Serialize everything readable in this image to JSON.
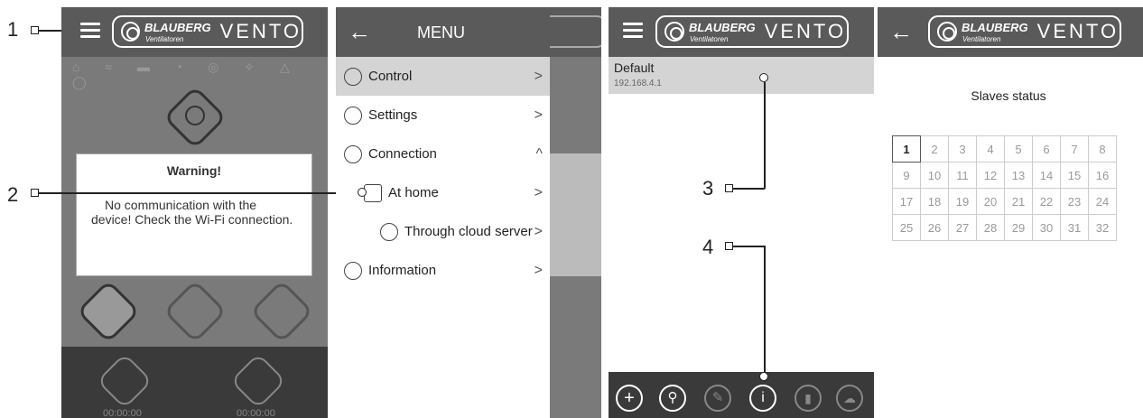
{
  "callouts": {
    "c1": "1",
    "c2": "2",
    "c3": "3",
    "c4": "4"
  },
  "panel1": {
    "logo_line1": "BLAUBERG",
    "logo_line2": "Ventilatoren",
    "logo_vento": "VENTO",
    "warning_title": "Warning!",
    "warning_text": "No communication with the device! Check the Wi-Fi connection.",
    "timer1": "00:00:00",
    "timer2": "00:00:00"
  },
  "panel2": {
    "menu_title": "MENU",
    "items": [
      {
        "label": "Control",
        "arrow": ">"
      },
      {
        "label": "Settings",
        "arrow": ">"
      },
      {
        "label": "Connection",
        "arrow": "^"
      },
      {
        "label": "At home",
        "arrow": ">"
      },
      {
        "label": "Through cloud server",
        "arrow": ">"
      },
      {
        "label": "Information",
        "arrow": ">"
      }
    ]
  },
  "panel3": {
    "logo_line1": "BLAUBERG",
    "logo_line2": "Ventilatoren",
    "logo_vento": "VENTO",
    "device_name": "Default",
    "device_ip": "192.168.4.1"
  },
  "panel4": {
    "logo_line1": "BLAUBERG",
    "logo_line2": "Ventilatoren",
    "logo_vento": "VENTO",
    "title": "Slaves status",
    "slaves": [
      "1",
      "2",
      "3",
      "4",
      "5",
      "6",
      "7",
      "8",
      "9",
      "10",
      "11",
      "12",
      "13",
      "14",
      "15",
      "16",
      "17",
      "18",
      "19",
      "20",
      "21",
      "22",
      "23",
      "24",
      "25",
      "26",
      "27",
      "28",
      "29",
      "30",
      "31",
      "32"
    ]
  },
  "colors": {
    "header": "#5a5a5a",
    "dark": "#3a3a3a",
    "overlay": "#7a7a7a",
    "selected": "#d4d4d4"
  }
}
